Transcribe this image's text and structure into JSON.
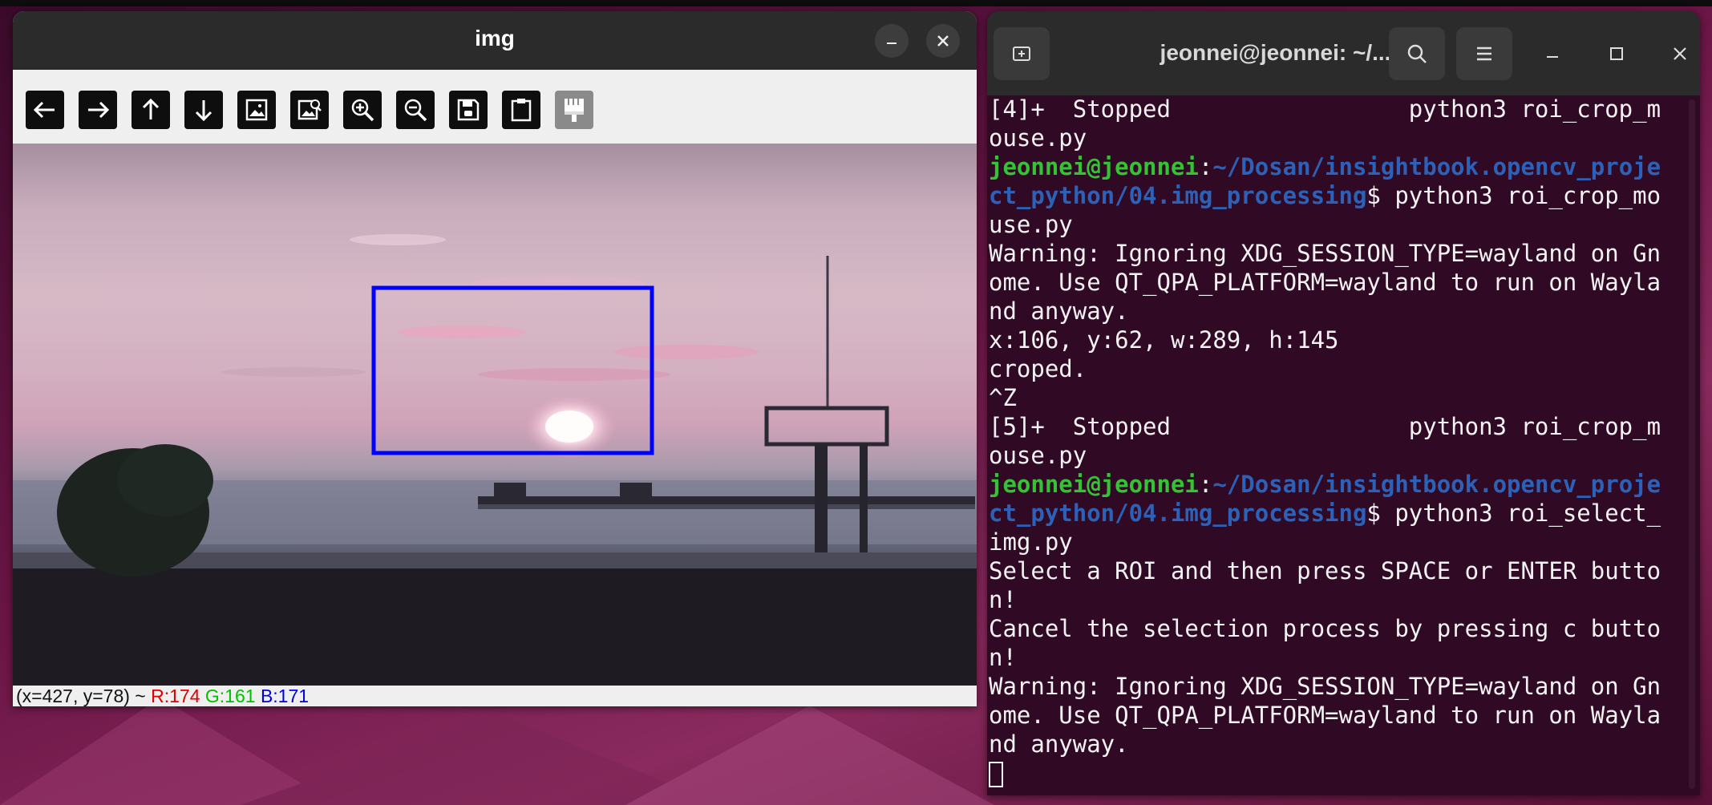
{
  "img_window": {
    "title": "img",
    "toolbar": [
      {
        "name": "arrow-left-icon"
      },
      {
        "name": "arrow-right-icon"
      },
      {
        "name": "arrow-up-icon"
      },
      {
        "name": "arrow-down-icon"
      },
      {
        "name": "image-icon"
      },
      {
        "name": "image-zoom-icon"
      },
      {
        "name": "zoom-in-icon"
      },
      {
        "name": "zoom-out-icon"
      },
      {
        "name": "save-icon"
      },
      {
        "name": "clipboard-icon"
      },
      {
        "name": "properties-icon"
      }
    ],
    "status": {
      "coords": "(x=427, y=78) ~ ",
      "r": "R:174",
      "g": "G:161",
      "b": "B:171"
    },
    "roi_color": "#0000ff"
  },
  "terminal": {
    "title": "jeonnei@jeonnei: ~/...",
    "colors": {
      "bg": "#300a24",
      "user": "#35c235",
      "path": "#2d61b8"
    },
    "lines": [
      {
        "segments": [
          {
            "t": "[4]+  Stopped                 python3 roi_crop_m"
          }
        ]
      },
      {
        "segments": [
          {
            "t": "ouse.py"
          }
        ]
      },
      {
        "segments": [
          {
            "c": "u",
            "t": "jeonnei@jeonnei"
          },
          {
            "t": ":"
          },
          {
            "c": "p",
            "t": "~/Dosan/insightbook.opencv_proje"
          }
        ]
      },
      {
        "segments": [
          {
            "c": "p",
            "t": "ct_python/04.img_processing"
          },
          {
            "t": "$ python3 roi_crop_mo"
          }
        ]
      },
      {
        "segments": [
          {
            "t": "use.py"
          }
        ]
      },
      {
        "segments": [
          {
            "t": "Warning: Ignoring XDG_SESSION_TYPE=wayland on Gn"
          }
        ]
      },
      {
        "segments": [
          {
            "t": "ome. Use QT_QPA_PLATFORM=wayland to run on Wayla"
          }
        ]
      },
      {
        "segments": [
          {
            "t": "nd anyway."
          }
        ]
      },
      {
        "segments": [
          {
            "t": "x:106, y:62, w:289, h:145"
          }
        ]
      },
      {
        "segments": [
          {
            "t": "croped."
          }
        ]
      },
      {
        "segments": [
          {
            "t": "^Z"
          }
        ]
      },
      {
        "segments": [
          {
            "t": "[5]+  Stopped                 python3 roi_crop_m"
          }
        ]
      },
      {
        "segments": [
          {
            "t": "ouse.py"
          }
        ]
      },
      {
        "segments": [
          {
            "c": "u",
            "t": "jeonnei@jeonnei"
          },
          {
            "t": ":"
          },
          {
            "c": "p",
            "t": "~/Dosan/insightbook.opencv_proje"
          }
        ]
      },
      {
        "segments": [
          {
            "c": "p",
            "t": "ct_python/04.img_processing"
          },
          {
            "t": "$ python3 roi_select_"
          }
        ]
      },
      {
        "segments": [
          {
            "t": "img.py"
          }
        ]
      },
      {
        "segments": [
          {
            "t": "Select a ROI and then press SPACE or ENTER butto"
          }
        ]
      },
      {
        "segments": [
          {
            "t": "n!"
          }
        ]
      },
      {
        "segments": [
          {
            "t": "Cancel the selection process by pressing c butto"
          }
        ]
      },
      {
        "segments": [
          {
            "t": "n!"
          }
        ]
      },
      {
        "segments": [
          {
            "t": "Warning: Ignoring XDG_SESSION_TYPE=wayland on Gn"
          }
        ]
      },
      {
        "segments": [
          {
            "t": "ome. Use QT_QPA_PLATFORM=wayland to run on Wayla"
          }
        ]
      },
      {
        "segments": [
          {
            "t": "nd anyway."
          }
        ]
      }
    ]
  }
}
